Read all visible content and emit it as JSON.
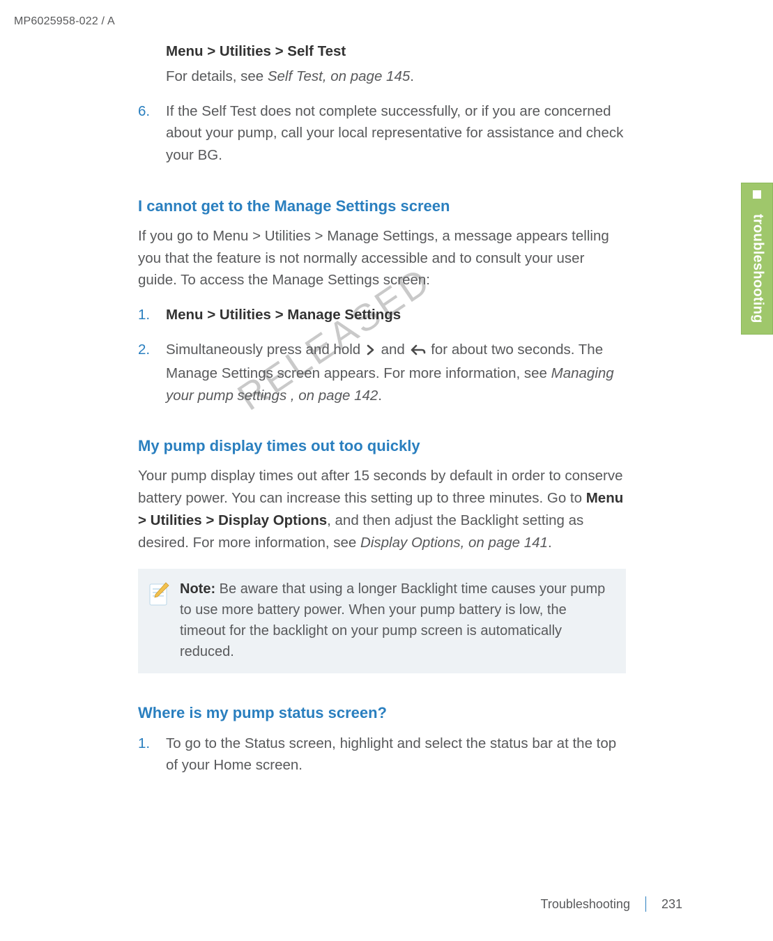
{
  "header_code": "MP6025958-022 / A",
  "side_tab_label": "troubleshooting",
  "watermark": "RELEASED",
  "intro": {
    "menu_path": "Menu > Utilities > Self Test",
    "details_prefix": "For details, see ",
    "details_ref": "Self Test, on page 145",
    "details_suffix": "."
  },
  "step6": {
    "num": "6.",
    "text": "If the Self Test does not complete successfully, or if you are concerned about your pump, call your local representative for assistance and check your BG."
  },
  "sec1": {
    "heading": "I cannot get to the Manage Settings screen",
    "para": "If you go to Menu > Utilities > Manage Settings, a message appears telling you that the feature is not normally accessible and to consult your user guide. To access the Manage Settings screen:",
    "step1": {
      "num": "1.",
      "text": "Menu > Utilities > Manage Settings"
    },
    "step2": {
      "num": "2.",
      "pre": "Simultaneously press and hold ",
      "mid": " and ",
      "post_a": " for about two seconds. The Manage Settings screen appears. For more information, see ",
      "ref": "Managing your pump settings , on page 142",
      "post_b": "."
    }
  },
  "sec2": {
    "heading": "My pump display times out too quickly",
    "para_a": "Your pump display times out after 15 seconds by default in order to conserve battery power. You can increase this setting up to three minutes. Go to ",
    "bold": "Menu > Utilities > Display Options",
    "para_b": ", and then adjust the Backlight setting as desired. For more information, see ",
    "ref": "Display Options, on page 141",
    "para_c": "."
  },
  "note": {
    "label": "Note:  ",
    "text": "Be aware that using a longer Backlight time causes your pump to use more battery power. When your pump battery is low, the timeout for the backlight on your pump screen is automatically reduced."
  },
  "sec3": {
    "heading": "Where is my pump status screen?",
    "step1": {
      "num": "1.",
      "text": "To go to the Status screen, highlight and select the status bar at the top of your Home screen."
    }
  },
  "footer": {
    "label": "Troubleshooting",
    "page": "231"
  }
}
